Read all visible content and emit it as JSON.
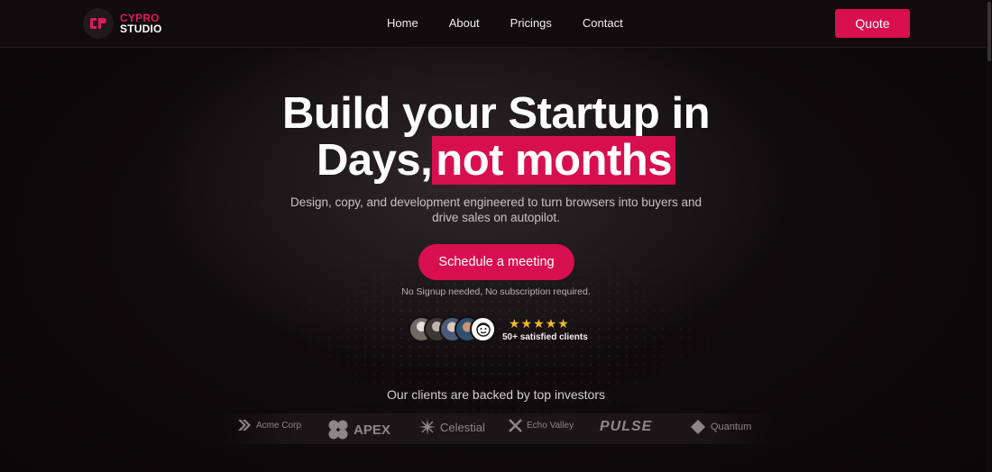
{
  "brand": {
    "line1": "CYPRO",
    "line2": "STUDIO",
    "accent": "#d80f4f",
    "icon": "cp-logo-icon"
  },
  "nav": {
    "items": [
      "Home",
      "About",
      "Pricings",
      "Contact"
    ],
    "quote_label": "Quote"
  },
  "hero": {
    "title_line1": "Build your Startup in",
    "title_line2_plain": "Days,",
    "title_line2_highlight": "not months",
    "subtitle": "Design, copy, and development engineered to turn browsers into buyers and drive sales on autopilot.",
    "cta_label": "Schedule a meeting",
    "note": "No Signup needed, No subscription required."
  },
  "social_proof": {
    "stars": "★★★★★",
    "rating": 5,
    "label": "50+ satisfied clients",
    "avatar_count": 5
  },
  "investors": {
    "heading": "Our clients are backed by top investors",
    "logos": [
      "Acme Corp",
      "APEX",
      "Celestial",
      "Echo Valley",
      "PULSE",
      "Quantum"
    ]
  }
}
